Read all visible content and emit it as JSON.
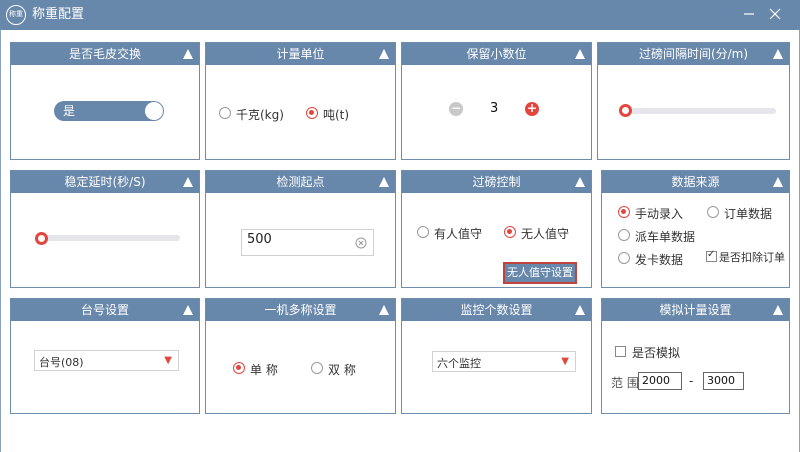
{
  "window": {
    "logo_text": "称重",
    "title": "称重配置"
  },
  "colors": {
    "accent": "#6888ab",
    "active": "#e2463f",
    "track": "#e4e6ec"
  },
  "icons": {
    "collapse": "triangle-up-icon",
    "clear": "circle-x-icon",
    "dropdown": "caret-down-icon"
  },
  "panels": {
    "peel": {
      "title": "是否毛皮交换",
      "toggle_label": "是",
      "on": true
    },
    "unit": {
      "title": "计量单位",
      "options": [
        "千克(kg)",
        "吨(t)"
      ],
      "selected": 1
    },
    "decimals": {
      "title": "保留小数位",
      "minus": "−",
      "plus": "+",
      "value": "3"
    },
    "interval": {
      "title": "过磅间隔时间(分/m)",
      "level": 0
    },
    "delay": {
      "title": "稳定延时(秒/S)",
      "level": 0
    },
    "threshold": {
      "title": "检测起点",
      "value": "500"
    },
    "control": {
      "title": "过磅控制",
      "options": [
        "有人值守",
        "无人值守"
      ],
      "selected": 1,
      "button": "无人值守设置"
    },
    "source": {
      "title": "数据来源",
      "options": [
        "手动录入",
        "订单数据",
        "派车单数据",
        "发卡数据"
      ],
      "selected": 0,
      "deduct_label": "是否扣除订单",
      "deduct_checked": true
    },
    "station": {
      "title": "台号设置",
      "value": "台号(08)"
    },
    "multi": {
      "title": "一机多称设置",
      "options": [
        "单 称",
        "双 称"
      ],
      "selected": 0
    },
    "monitor": {
      "title": "监控个数设置",
      "value": "六个监控"
    },
    "simulate": {
      "title": "模拟计量设置",
      "checkbox_label": "是否模拟",
      "checked": false,
      "range_label": "范 围",
      "from": "2000",
      "dash": "-",
      "to": "3000"
    }
  }
}
